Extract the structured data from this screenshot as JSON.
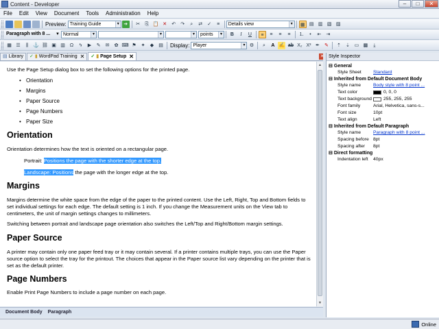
{
  "window": {
    "title": "Content - Developer"
  },
  "menu": [
    "File",
    "Edit",
    "View",
    "Document",
    "Tools",
    "Administration",
    "Help"
  ],
  "toolbar1": {
    "preview_label": "Preview:",
    "preview_value": "Training Guide",
    "view_value": "Details view"
  },
  "toolbar2": {
    "style_value": "Paragraph with 8 ...",
    "font_value": "Normal",
    "size_value": "",
    "units_value": "points"
  },
  "toolbar3": {
    "display_label": "Display:",
    "display_value": "Player"
  },
  "tabs": [
    {
      "label": "Library"
    },
    {
      "label": "WordPad Training"
    },
    {
      "label": "Page Setup"
    }
  ],
  "document": {
    "intro": "Use the Page Setup dialog box to set the following options for the printed page.",
    "bullets": [
      "Orientation",
      "Margins",
      "Paper Source",
      "Page Numbers",
      "Paper Size"
    ],
    "h_orientation": "Orientation",
    "p_orientation": "Orientation determines how the text is oriented on a rectangular page.",
    "portrait_label": "Portrait:",
    "portrait_text": "Positions the page with the shorter edge at the top.",
    "landscape_label": "Landscape: Positions",
    "landscape_text": "the page with the longer edge at the top.",
    "h_margins": "Margins",
    "p_margins1": "Margins determine the white space from the edge of the paper to the printed content. Use the Left, Right, Top and Bottom fields to set individual settings for each edge. The default setting is 1 inch. If you change the Measurement units on the View tab to centimeters, the unit of margin settings changes to millimeters.",
    "p_margins2": "Switching between portrait and landscape page orientation also switches the Left/Top and Right/Bottom margin settings.",
    "h_papersource": "Paper Source",
    "p_papersource": "A printer may contain only one paper feed tray or it may contain several. If a printer contains multiple trays, you can use the Paper source option to select the tray for the printout. The choices that appear in the Paper source list vary depending on the printer that is set as the default printer.",
    "h_pagenumbers": "Page Numbers",
    "p_pagenumbers": "Enable Print Page Numbers to include a page number on each page."
  },
  "doc_status": [
    "Document Body",
    "Paragraph"
  ],
  "inspector": {
    "title": "Style Inspector",
    "general": "General",
    "style_sheet_k": "Style Sheet",
    "style_sheet_v": "Standard",
    "inherited_body": "Inherited from Default Document Body",
    "style_name_k": "Style name",
    "style_name_v": "Body style with 8 point ...",
    "text_color_k": "Text color",
    "text_color_v": "0, 0, 0",
    "text_bg_k": "Text background color",
    "text_bg_v": "255, 255, 255",
    "font_family_k": "Font family",
    "font_family_v": "Arial, Helvetica, sans-s...",
    "font_size_k": "Font size",
    "font_size_v": "10pt",
    "text_align_k": "Text align",
    "text_align_v": "Left",
    "inherited_para": "Inherited from Default Paragraph",
    "style_name2_k": "Style name",
    "style_name2_v": "Paragraph with 8 point ...",
    "spacing_before_k": "Spacing before",
    "spacing_before_v": "8pt",
    "spacing_after_k": "Spacing after",
    "spacing_after_v": "8pt",
    "direct": "Direct formatting",
    "indent_k": "Indentation left",
    "indent_v": "40px"
  },
  "status": {
    "online": "Online"
  },
  "colors": {
    "highlight": "#3399ff",
    "link": "#0033cc"
  }
}
